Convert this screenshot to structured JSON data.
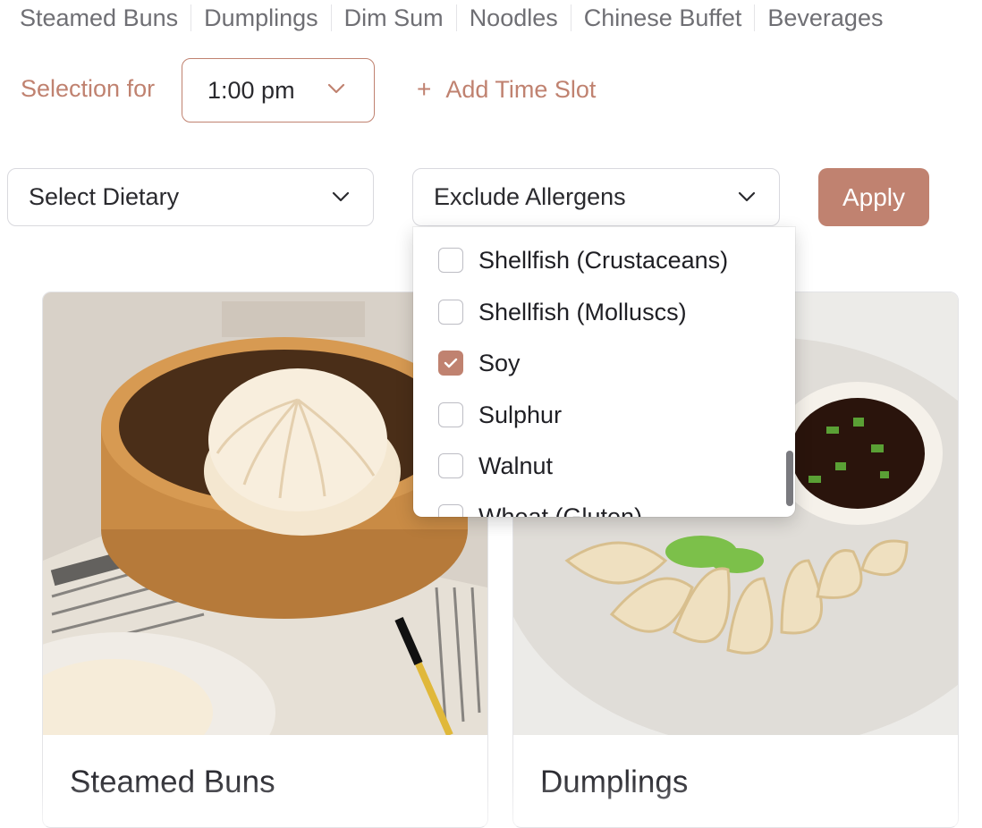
{
  "categories": [
    "Steamed Buns",
    "Dumplings",
    "Dim Sum",
    "Noodles",
    "Chinese Buffet",
    "Beverages"
  ],
  "selection": {
    "label": "Selection for",
    "time_value": "1:00 pm",
    "add_slot_label": "Add Time Slot",
    "add_slot_icon": "+"
  },
  "filters": {
    "dietary_placeholder": "Select Dietary",
    "allergens_placeholder": "Exclude Allergens",
    "apply_label": "Apply"
  },
  "allergen_options": [
    {
      "label": "Shellfish (Crustaceans)",
      "checked": false
    },
    {
      "label": "Shellfish (Molluscs)",
      "checked": false
    },
    {
      "label": "Soy",
      "checked": true
    },
    {
      "label": "Sulphur",
      "checked": false
    },
    {
      "label": "Walnut",
      "checked": false
    },
    {
      "label": "Wheat (Gluten)",
      "checked": false
    }
  ],
  "cards": [
    {
      "title": "Steamed Buns",
      "image": "steamed-bun-photo"
    },
    {
      "title": "Dumplings",
      "image": "dumplings-photo"
    }
  ],
  "colors": {
    "accent": "#c08270",
    "text": "#2a2a2e",
    "muted": "#6f6f74",
    "border": "#d9d9de"
  }
}
